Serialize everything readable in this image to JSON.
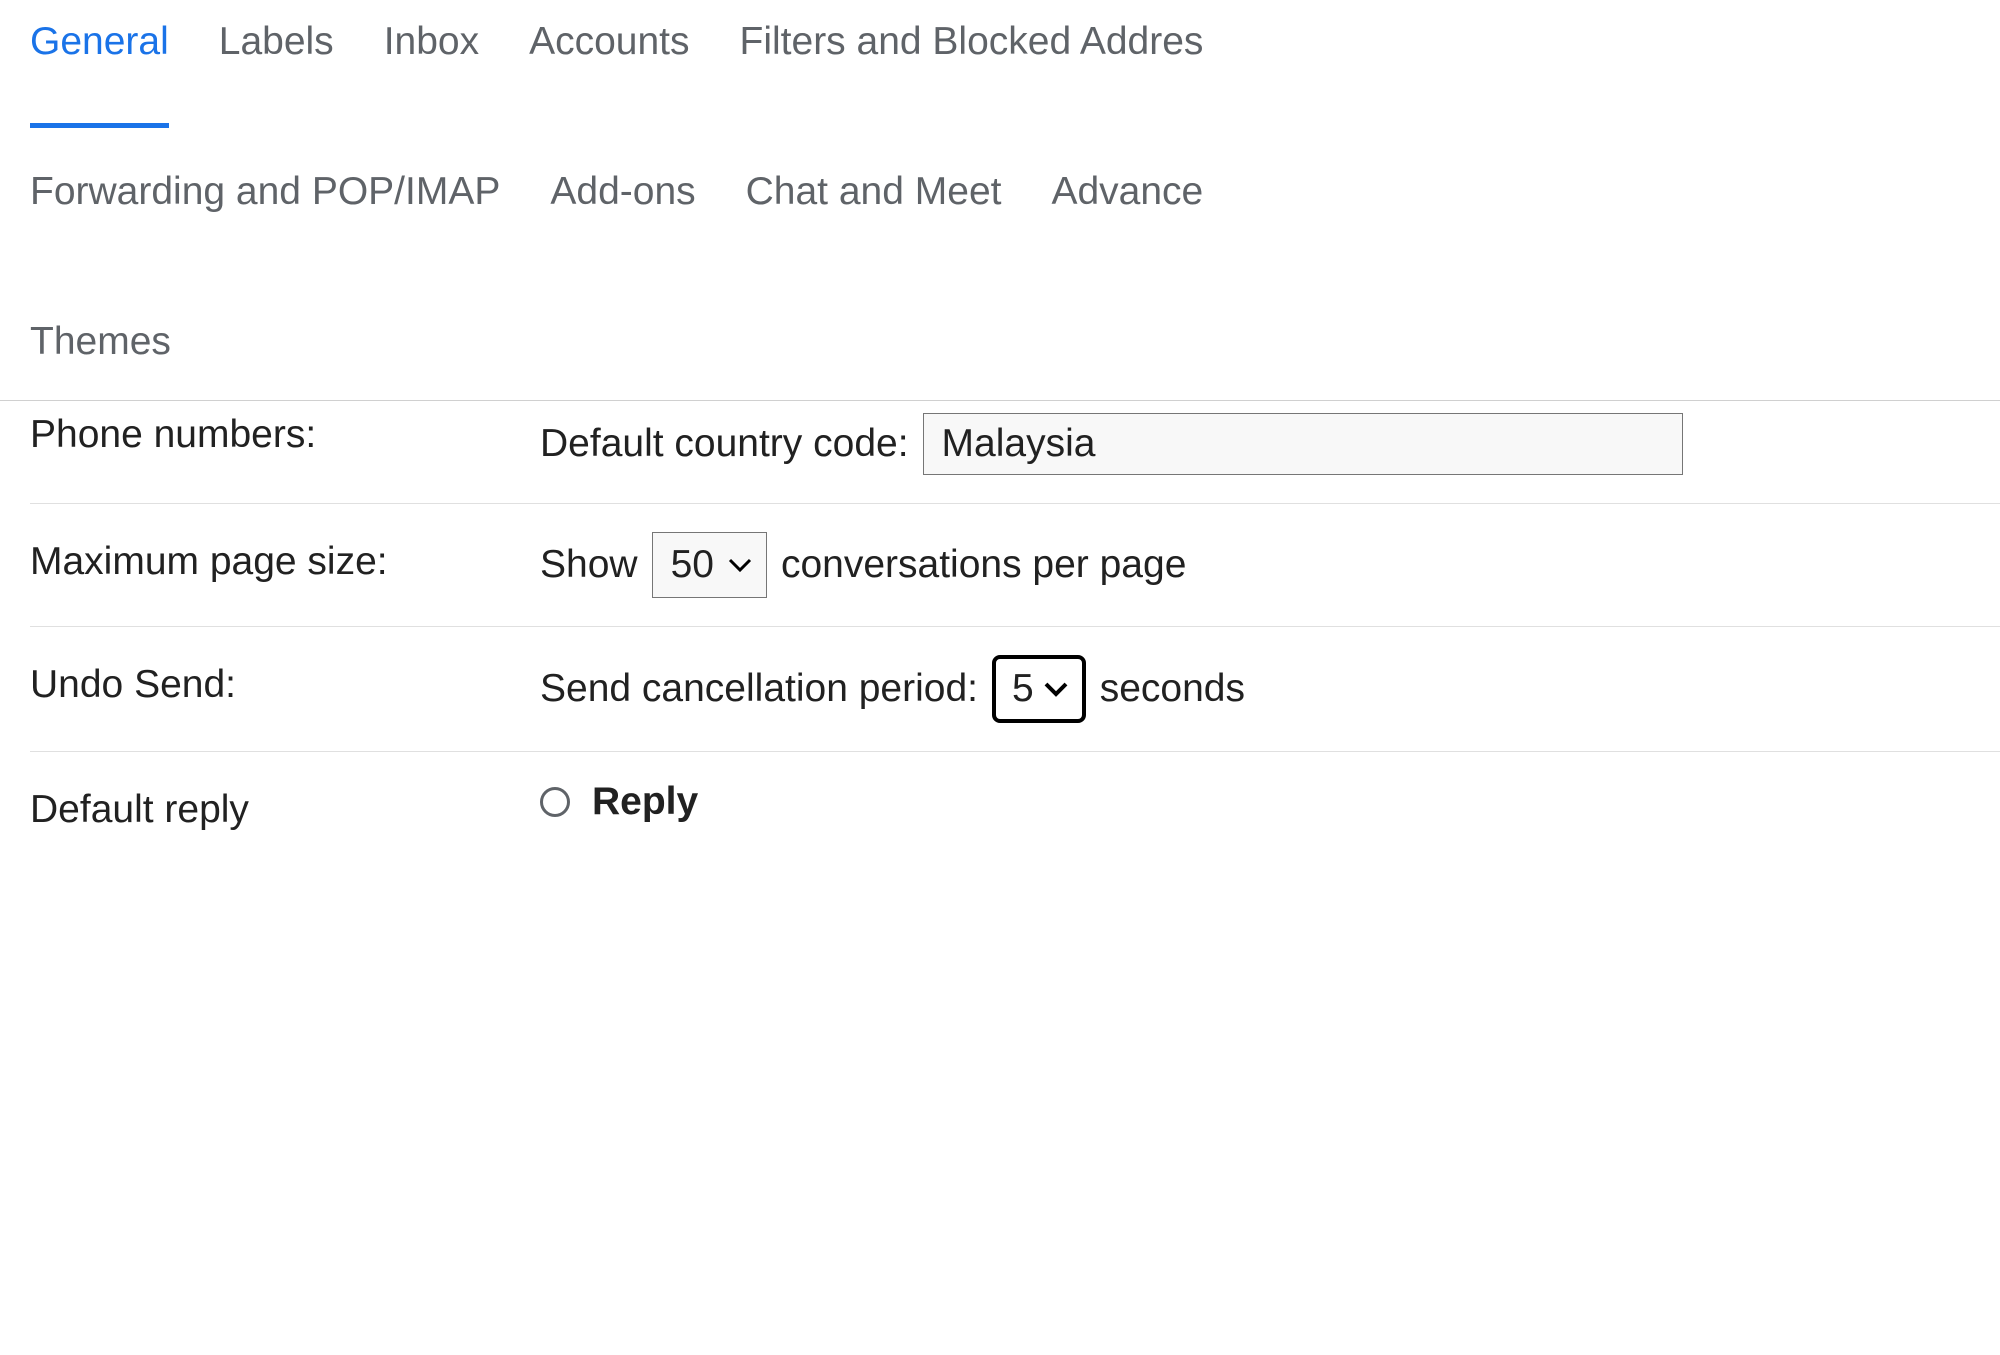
{
  "tabs": {
    "row1": [
      "General",
      "Labels",
      "Inbox",
      "Accounts",
      "Filters and Blocked Addres"
    ],
    "row2": [
      "Forwarding and POP/IMAP",
      "Add-ons",
      "Chat and Meet",
      "Advance"
    ],
    "row3": [
      "Themes"
    ],
    "activeIndex": 0
  },
  "phoneNumbers": {
    "label": "Phone numbers:",
    "fieldLabel": "Default country code:",
    "value": "Malaysia"
  },
  "pageSize": {
    "label": "Maximum page size:",
    "textBefore": "Show",
    "value": "50",
    "textAfter": "conversations per page"
  },
  "undoSend": {
    "label": "Undo Send:",
    "textBefore": "Send cancellation period:",
    "value": "5",
    "textAfter": "seconds"
  },
  "defaultReply": {
    "label": "Default reply",
    "option1": "Reply"
  }
}
